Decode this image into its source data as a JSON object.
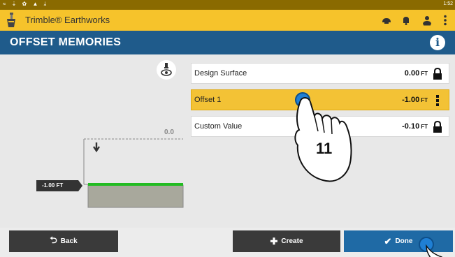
{
  "status_bar": {
    "icons": "≈ ⇣ ✿ ▲ ⤓",
    "time": "1:52"
  },
  "app_bar": {
    "title": "Trimble® Earthworks"
  },
  "header": {
    "title": "OFFSET MEMORIES",
    "info_glyph": "i"
  },
  "diagram": {
    "top_value": "0.0",
    "offset_tag": "-1.00 FT"
  },
  "levels": [
    {
      "label": "Design Surface",
      "value": "0.00",
      "unit": "FT",
      "icon": "lock-icon",
      "selected": false
    },
    {
      "label": "Offset 1",
      "value": "-1.00",
      "unit": "FT",
      "icon": "kebab-menu-icon",
      "selected": true
    },
    {
      "label": "Custom Value",
      "value": "-0.10",
      "unit": "FT",
      "icon": "lock-icon",
      "selected": false
    }
  ],
  "annotation": {
    "step_number": "11"
  },
  "buttons": {
    "back": "Back",
    "create": "Create",
    "done": "Done"
  },
  "colors": {
    "accent_yellow": "#f6c32b",
    "header_blue": "#1f5b8b",
    "done_blue": "#1f6aa5",
    "surface_green": "#22bb22"
  }
}
